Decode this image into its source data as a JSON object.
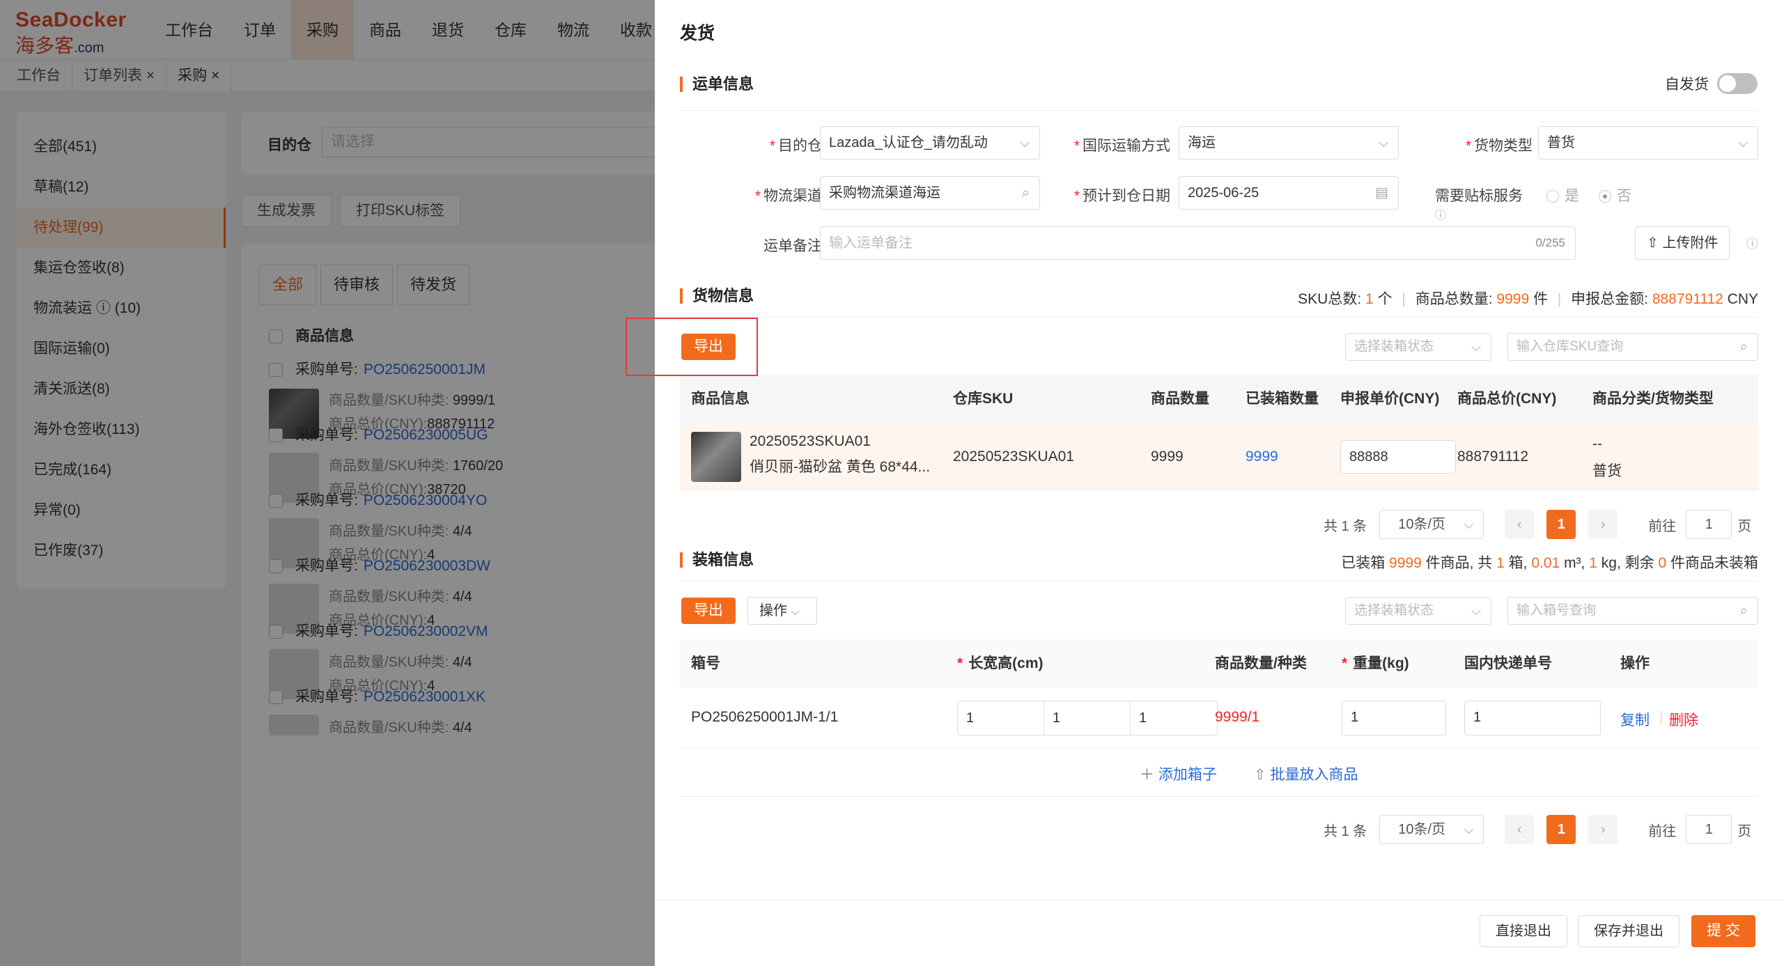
{
  "brand": {
    "line1": "SeaDocker",
    "line2": "海多客",
    "domain": ".com"
  },
  "nav": [
    "工作台",
    "订单",
    "采购",
    "商品",
    "退货",
    "仓库",
    "物流",
    "收款"
  ],
  "nav_active": 2,
  "tabs": [
    "工作台",
    "订单列表 ×",
    "采购 ×"
  ],
  "left_menu": [
    "全部(451)",
    "草稿(12)",
    "待处理(99)",
    "集运仓签收(8)",
    "物流装运 ⓘ (10)",
    "国际运输(0)",
    "清关派送(8)",
    "海外仓签收(113)",
    "已完成(164)",
    "异常(0)",
    "已作废(37)"
  ],
  "filter": {
    "label": "目的仓",
    "placeholder": "请选择"
  },
  "bg_buttons": [
    "生成发票",
    "打印SKU标签"
  ],
  "list_tabs": [
    "全部",
    "待审核",
    "待发货"
  ],
  "list_header": "商品信息",
  "po_label": "采购单号:",
  "orders": [
    {
      "po": "PO2506250001JM",
      "qty_label": "商品数量/SKU种类:",
      "qty": "9999/1",
      "total_label": "商品总价(CNY):",
      "total": "888791112"
    },
    {
      "po": "PO2506230005UG",
      "qty_label": "商品数量/SKU种类:",
      "qty": "1760/20",
      "total_label": "商品总价(CNY):",
      "total": "38720"
    },
    {
      "po": "PO2506230004YO",
      "qty_label": "商品数量/SKU种类:",
      "qty": "4/4",
      "total_label": "商品总价(CNY):",
      "total": "4"
    },
    {
      "po": "PO2506230003DW",
      "qty_label": "商品数量/SKU种类:",
      "qty": "4/4",
      "total_label": "商品总价(CNY):",
      "total": "4"
    },
    {
      "po": "PO2506230002VM",
      "qty_label": "商品数量/SKU种类:",
      "qty": "4/4",
      "total_label": "商品总价(CNY):",
      "total": "4"
    },
    {
      "po": "PO2506230001XK",
      "qty_label": "商品数量/SKU种类:",
      "qty": "4/4",
      "total_label": "",
      "total": ""
    }
  ],
  "drawer": {
    "title": "发货",
    "waybill": {
      "section": "运单信息",
      "self_ship": "自发货",
      "dest_label": "目的仓",
      "dest_value": "Lazada_认证仓_请勿乱动",
      "intl_label": "国际运输方式",
      "intl_value": "海运",
      "cargo_label": "货物类型",
      "cargo_value": "普货",
      "channel_label": "物流渠道",
      "channel_value": "采购物流渠道海运",
      "eta_label": "预计到仓日期",
      "eta_value": "2025-06-25",
      "label_service": "需要贴标服务",
      "yes": "是",
      "no": "否",
      "remark_label": "运单备注",
      "remark_placeholder": "输入运单备注",
      "remark_count": "0/255",
      "upload": "上传附件"
    },
    "goods": {
      "section": "货物信息",
      "sku_total_label": "SKU总数:",
      "sku_total": "1",
      "sku_unit": "个",
      "qty_total_label": "商品总数量:",
      "qty_total": "9999",
      "qty_unit": "件",
      "amount_label": "申报总金额:",
      "amount": "888791112",
      "amount_unit": "CNY",
      "export": "导出",
      "status_placeholder": "选择装箱状态",
      "sku_search_placeholder": "输入仓库SKU查询",
      "headers": [
        "商品信息",
        "仓库SKU",
        "商品数量",
        "已装箱数量",
        "申报单价(CNY)",
        "商品总价(CNY)",
        "商品分类/货物类型"
      ],
      "row": {
        "sku_code": "20250523SKUA01",
        "name": "俏贝丽-猫砂盆 黄色 68*44...",
        "warehouse_sku": "20250523SKUA01",
        "qty": "9999",
        "packed": "9999",
        "unit_price": "88888",
        "total": "888791112",
        "category": "--",
        "cargo": "普货"
      }
    },
    "pager": {
      "total": "共 1 条",
      "size": "10条/页",
      "page": "1",
      "goto": "前往",
      "goto_val": "1",
      "page_unit": "页"
    },
    "packing": {
      "section": "装箱信息",
      "summary_pre": "已装箱",
      "packed_items": "9999",
      "summary_mid1": "件商品,  共",
      "boxes": "1",
      "summary_mid2": "箱,",
      "volume": "0.01",
      "vol_unit": "m³,",
      "weight": "1",
      "summary_mid3": "kg, 剩余",
      "remain": "0",
      "summary_post": "件商品未装箱",
      "export": "导出",
      "operate": "操作",
      "status_placeholder": "选择装箱状态",
      "box_search_placeholder": "输入箱号查询",
      "headers": [
        "箱号",
        "长宽高(cm)",
        "商品数量/种类",
        "重量(kg)",
        "国内快递单号",
        "操作"
      ],
      "row": {
        "box": "PO2506250001JM-1/1",
        "l": "1",
        "w": "1",
        "h": "1",
        "qty": "9999/1",
        "weight": "1",
        "tracking": "1",
        "copy": "复制",
        "delete": "删除"
      },
      "add_box": "添加箱子",
      "batch": "批量放入商品"
    },
    "footer": {
      "exit": "直接退出",
      "save_exit": "保存并退出",
      "submit": "提 交"
    }
  },
  "colors": {
    "accent": "#f26b1d",
    "link": "#2a6ad8",
    "danger": "#f5222d"
  }
}
